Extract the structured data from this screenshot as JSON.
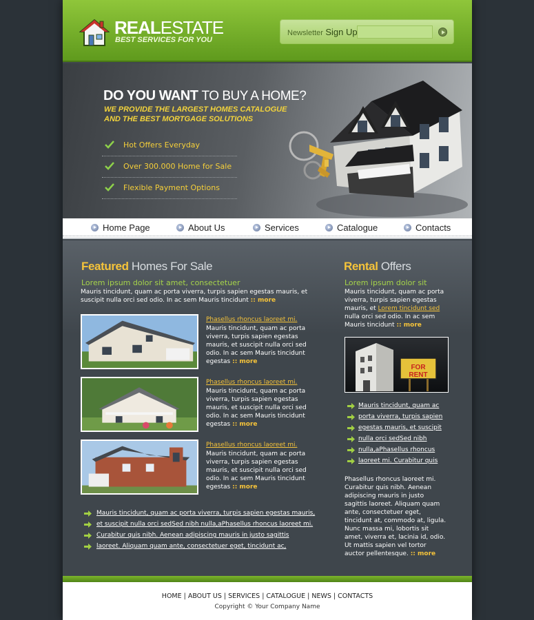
{
  "header": {
    "logo_bold": "REAL",
    "logo_light": "ESTATE",
    "logo_tagline": "BEST SERVICES FOR YOU",
    "newsletter_label_1": "Newsletter",
    "newsletter_label_2": "Sign Up",
    "newsletter_value": ""
  },
  "hero": {
    "title_bold": "DO YOU WANT",
    "title_light": "TO BUY A HOME?",
    "sub_line_1": "WE PROVIDE THE LARGEST HOMES CATALOGUE",
    "sub_line_2": "AND THE BEST MORTGAGE SOLUTIONS",
    "items": [
      "Hot Offers Everyday",
      "Over 300.000 Home for Sale",
      "Flexible Payment Options"
    ]
  },
  "nav": {
    "items": [
      "Home Page",
      "About Us",
      "Services",
      "Catalogue",
      "Contacts"
    ]
  },
  "featured": {
    "title_bold": "Featured",
    "title_light": "Homes For Sale",
    "lead": "Lorem ipsum dolor sit amet, consectetuer",
    "intro_line_1": "Mauris tincidunt, quam ac porta viverra, turpis sapien egestas mauris, et",
    "intro_line_2": "suscipit nulla orci sed odio. In ac sem Mauris tincidunt",
    "more": ":: more",
    "listings": [
      {
        "link": "Phasellus rhoncus laoreet mi.",
        "text": "Mauris tincidunt, quam ac porta viverra, turpis sapien egestas mauris, et suscipit nulla orci sed odio. In ac sem Mauris tincidunt egestas"
      },
      {
        "link": "Phasellus rhoncus laoreet mi.",
        "text": "Mauris tincidunt, quam ac porta viverra, turpis sapien egestas mauris, et suscipit nulla orci sed odio. In ac sem Mauris tincidunt egestas"
      },
      {
        "link": "Phasellus rhoncus laoreet mi.",
        "text": "Mauris tincidunt, quam ac porta viverra, turpis sapien egestas mauris, et suscipit nulla orci sed odio. In ac sem Mauris tincidunt egestas"
      }
    ],
    "links": [
      "Mauris tincidunt, quam ac porta viverra, turpis sapien egestas mauris,",
      "et suscipit nulla orci sedSed nibh nulla,aPhasellus rhoncus laoreet mi.",
      "Curabitur quis nibh. Aenean adipiscing mauris in justo sagittis",
      "laoreet. Aliquam quam ante, consectetuer eget, tincidunt ac,"
    ]
  },
  "rental": {
    "title_bold": "Rental",
    "title_light": "Offers",
    "lead": "Lorem ipsum dolor sit",
    "intro_1": "Mauris tincidunt, quam ac porta",
    "intro_2": "viverra, turpis sapien egestas",
    "intro_3a": "mauris, et",
    "intro_3_link": "Lorem tincidunt sed",
    "intro_4": "nulla orci sed odio. In ac sem",
    "intro_5": "Mauris tincidunt",
    "sign_text": "FOR RENT",
    "links": [
      "Mauris tincidunt, quam ac",
      "porta viverra, turpis sapien",
      "egestas mauris, et suscipit",
      "nulla orci sedSed nibh",
      "nulla,aPhasellus rhoncus",
      "laoreet mi. Curabitur quis"
    ],
    "outro": "Phasellus rhoncus laoreet mi. Curabitur quis nibh. Aenean adipiscing mauris in justo sagittis laoreet. Aliquam quam ante, consectetuer eget, tincidunt at, commodo at, ligula. Nunc massa mi, lobortis sit amet, viverra et, lacinia id, odio. Ut mattis sapien vel tortor auctor pellentesque."
  },
  "footer": {
    "links": [
      "HOME",
      "ABOUT US",
      "SERVICES",
      "CATALOGUE",
      "NEWS",
      "CONTACTS"
    ],
    "copyright": "Copyright © Your Company Name"
  }
}
